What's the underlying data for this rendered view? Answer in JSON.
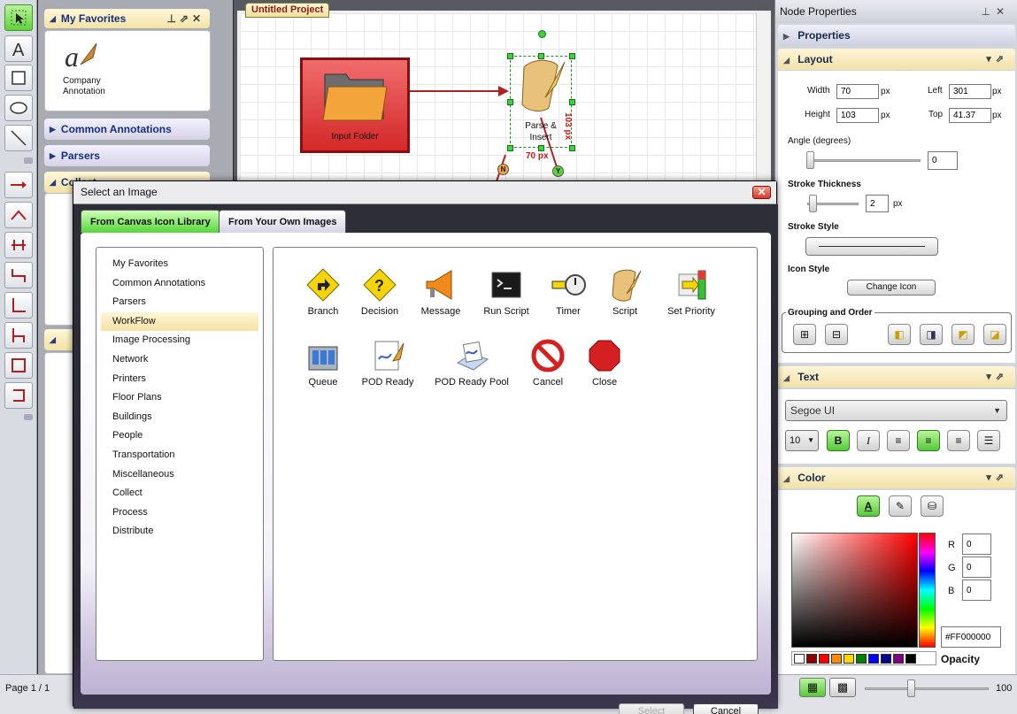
{
  "canvas": {
    "tab_title": "Untitled Project",
    "node_input_label": "Input Folder",
    "node_parse_label": "Parse &\nInsert",
    "dim_width": "70 px",
    "dim_height": "103 px",
    "port_no": "N",
    "port_yes": "Y"
  },
  "left_panel": {
    "favorites_header": "My Favorites",
    "favorite_item": "Company\nAnnotation",
    "sections": [
      "Common Annotations",
      "Parsers",
      "Collect"
    ]
  },
  "right_panel": {
    "title": "Node Properties",
    "sections": {
      "properties": "Properties",
      "layout": "Layout",
      "text": "Text",
      "color": "Color"
    },
    "layout": {
      "width_label": "Width",
      "width_value": "70",
      "width_unit": "px",
      "height_label": "Height",
      "height_value": "103",
      "height_unit": "px",
      "left_label": "Left",
      "left_value": "301",
      "left_unit": "px",
      "top_label": "Top",
      "top_value": "41.37",
      "top_unit": "px",
      "angle_label": "Angle (degrees)",
      "angle_value": "0",
      "stroke_thickness_label": "Stroke Thickness",
      "stroke_thickness_value": "2",
      "stroke_thickness_unit": "px",
      "stroke_style_label": "Stroke Style",
      "icon_style_label": "Icon Style",
      "change_icon_button": "Change Icon",
      "grouping_label": "Grouping and Order"
    },
    "text": {
      "font_family": "Segoe UI",
      "font_size": "10",
      "bold": "B",
      "italic": "I"
    },
    "color": {
      "r_label": "R",
      "r_value": "0",
      "g_label": "G",
      "g_value": "0",
      "b_label": "B",
      "b_value": "0",
      "hex_value": "#FF000000",
      "opacity_label": "Opacity",
      "swatches": [
        "#ffffff",
        "#8b0000",
        "#ff0000",
        "#ff8c00",
        "#ffd700",
        "#008000",
        "#0000ff",
        "#00008b",
        "#800080",
        "#000000"
      ]
    }
  },
  "status": {
    "page_label": "Page 1 / 1",
    "zoom_label": "100"
  },
  "dialog": {
    "title": "Select an Image",
    "close": "✕",
    "tabs": [
      "From Canvas Icon Library",
      "From Your Own Images"
    ],
    "categories": [
      "My Favorites",
      "Common Annotations",
      "Parsers",
      "WorkFlow",
      "Image Processing",
      "Network",
      "Printers",
      "Floor Plans",
      "Buildings",
      "People",
      "Transportation",
      "Miscellaneous",
      "Collect",
      "Process",
      "Distribute"
    ],
    "selected_category": "WorkFlow",
    "icons": [
      "Branch",
      "Decision",
      "Message",
      "Run Script",
      "Timer",
      "Script",
      "Set Priority",
      "Queue",
      "POD Ready",
      "POD Ready Pool",
      "Cancel",
      "Close"
    ],
    "select_button": "Select",
    "cancel_button": "Cancel"
  }
}
